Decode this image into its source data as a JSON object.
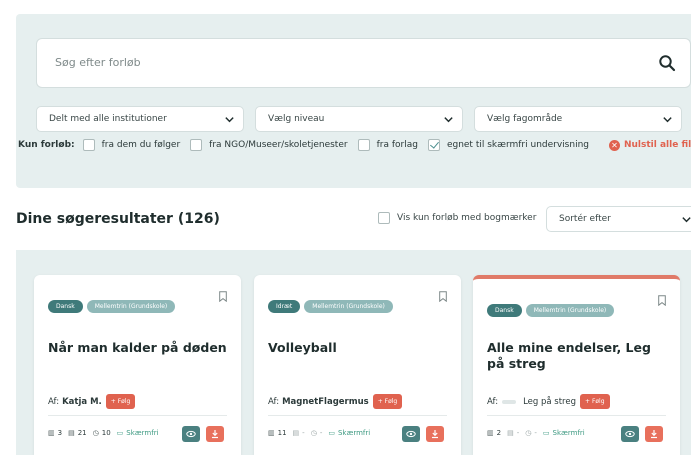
{
  "search": {
    "placeholder": "Søg efter forløb"
  },
  "selects": {
    "institutions": "Delt med alle institutioner",
    "level": "Vælg niveau",
    "subject_area": "Vælg fagområde"
  },
  "filters": {
    "lead": "Kun forløb:",
    "options": [
      {
        "label": "fra dem du følger",
        "checked": false
      },
      {
        "label": "fra NGO/Museer/skoletjenester",
        "checked": false
      },
      {
        "label": "fra forlag",
        "checked": false
      },
      {
        "label": "egnet til skærmfri undervisning",
        "checked": true
      }
    ],
    "reset": "Nulstil alle filtre"
  },
  "results": {
    "title": "Dine søgeresultater (126)",
    "bookmark_only": "Vis kun forløb med bogmærker",
    "sort": "Sortér efter"
  },
  "cards": [
    {
      "subject": "Dansk",
      "level": "Mellemtrin (Grundskole)",
      "title": "Når man kalder på døden",
      "author_prefix": "Af:",
      "author": "Katja M.",
      "follow": "Følg",
      "stat1": "3",
      "stat2": "21",
      "stat3": "10",
      "screenfree": "Skærmfri",
      "accent": false
    },
    {
      "subject": "Idræt",
      "level": "Mellemtrin (Grundskole)",
      "title": "Volleyball",
      "author_prefix": "Af:",
      "author": "MagnetFlagermus",
      "follow": "Følg",
      "stat1": "11",
      "stat2": "-",
      "stat3": "-",
      "screenfree": "Skærmfri",
      "accent": false
    },
    {
      "subject": "Dansk",
      "level": "Mellemtrin (Grundskole)",
      "title": "Alle mine endelser, Leg på streg",
      "author_prefix": "Af:",
      "author": "Leg på streg",
      "follow": "Følg",
      "stat1": "2",
      "stat2": "-",
      "stat3": "-",
      "screenfree": "Skærmfri",
      "accent": true
    }
  ],
  "colors": {
    "panel": "#e6efef",
    "accent_orange": "#e0624f",
    "teal_dark": "#3f7a7a",
    "teal_light": "#8fb8b8"
  }
}
